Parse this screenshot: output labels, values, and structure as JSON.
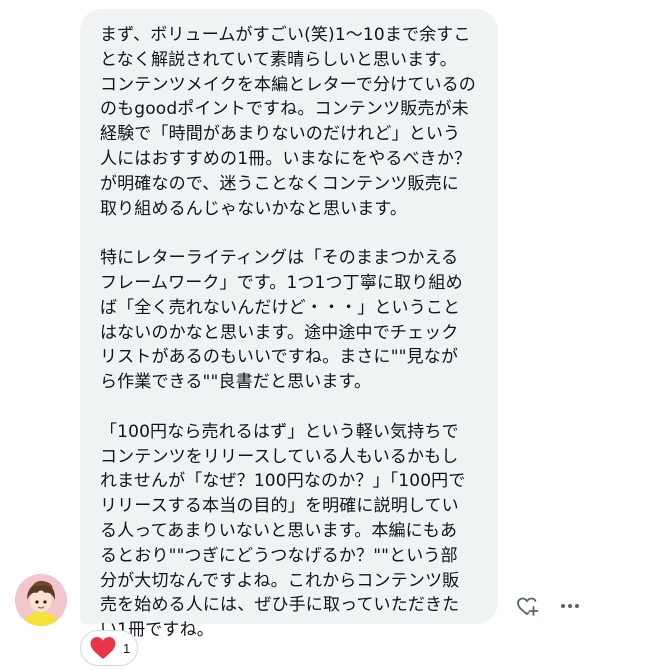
{
  "message": {
    "lines": [
      "まず、ボリュームがすごい(笑)1〜10まで余すこ",
      "となく解説されていて素晴らしいと思います。",
      "コンテンツメイクを本編とレターで分けているの",
      "のもgoodポイントですね。コンテンツ販売が未",
      "経験で「時間があまりないのだけれど」という",
      "人にはおすすめの1冊。いまなにをやるべきか？",
      "が明確なので、迷うことなくコンテンツ販売に",
      "取り組めるんじゃないかなと思います。",
      "",
      "特にレターライティングは「そのままつかえる",
      "フレームワーク」です。1つ1つ丁寧に取り組め",
      "ば「全く売れないんだけど・・・」ということ",
      "はないのかなと思います。途中途中でチェック",
      "リストがあるのもいいですね。まさに\"\"見なが",
      "ら作業できる\"\"良書だと思います。",
      "",
      "「100円なら売れるはず」という軽い気持ちで",
      "コンテンツをリリースしている人もいるかもし",
      "れませんが「なぜ？100円なのか？」「100円で",
      "リリースする本当の目的」を明確に説明してい",
      "る人ってあまりいないと思います。本編にもあ",
      "るとおり\"\"つぎにどうつなげるか？\"\"という部",
      "分が大切なんですよね。これからコンテンツ販",
      "売を始める人には、ぜひ手に取っていただきた",
      "い1冊ですね。"
    ]
  },
  "reactions": {
    "heart_count": "1"
  },
  "icons": {
    "avatar": "user-avatar",
    "add_reaction": "heart-plus-icon",
    "more": "more-horizontal-icon",
    "heart": "heart-icon"
  },
  "colors": {
    "bubble_bg": "#eff3f4",
    "text": "#0f1419",
    "heart": "#f91880",
    "icon": "#536471"
  }
}
